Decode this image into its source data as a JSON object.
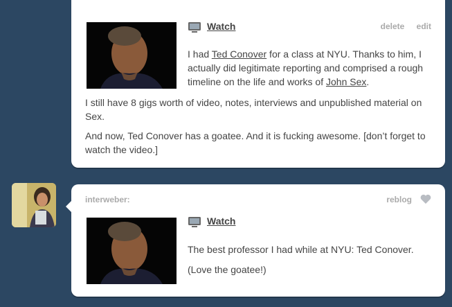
{
  "post1": {
    "watch_label": "Watch",
    "delete_label": "delete",
    "edit_label": "edit",
    "para1": {
      "t1": "I had ",
      "link1": "Ted Conover",
      "t2": " for a class at NYU. Thanks to him, I actually did legitimate reporting and comprised a rough timeline on the life and works of ",
      "link2": "John Sex",
      "t3": "."
    },
    "para2": "I still have 8 gigs worth of video, notes, interviews and unpublished material on Sex.",
    "para3": "And now, Ted Conover has a goatee. And it is fucking awesome. [don’t forget to watch the video.]"
  },
  "post2": {
    "username": "interweber:",
    "reblog_label": "reblog",
    "watch_label": "Watch",
    "para1": "The best professor I had while at NYU: Ted Conover.",
    "para2": "(Love the goatee!)"
  },
  "icons": {
    "video": "tv-icon",
    "like": "heart-icon"
  },
  "colors": {
    "background": "#2c4762",
    "card": "#ffffff",
    "muted": "#aaaaaa",
    "text": "#444444"
  }
}
